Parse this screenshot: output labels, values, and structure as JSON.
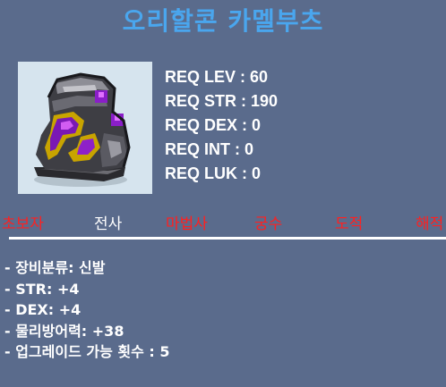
{
  "item": {
    "name": "오리할콘 카멜부츠",
    "icon": "boots-icon",
    "colors": {
      "title": "#4aa6ee",
      "background": "#5a6b8c",
      "icon_bg": "#d6e4ee",
      "job_allowed": "#ffffff",
      "job_disallowed": "#ff2020"
    }
  },
  "requirements": [
    {
      "label": "REQ LEV : 60"
    },
    {
      "label": "REQ STR : 190"
    },
    {
      "label": "REQ DEX : 0"
    },
    {
      "label": "REQ INT : 0"
    },
    {
      "label": "REQ LUK : 0"
    }
  ],
  "jobs": [
    {
      "label": "초보자",
      "allowed": false
    },
    {
      "label": "전사",
      "allowed": true
    },
    {
      "label": "마법사",
      "allowed": false
    },
    {
      "label": "궁수",
      "allowed": false
    },
    {
      "label": "도적",
      "allowed": false
    },
    {
      "label": "해적",
      "allowed": false
    }
  ],
  "stats": [
    "- 장비분류: 신발",
    "- STR: +4",
    "- DEX: +4",
    "- 물리방어력: +38",
    "- 업그레이드 가능 횟수 : 5"
  ]
}
